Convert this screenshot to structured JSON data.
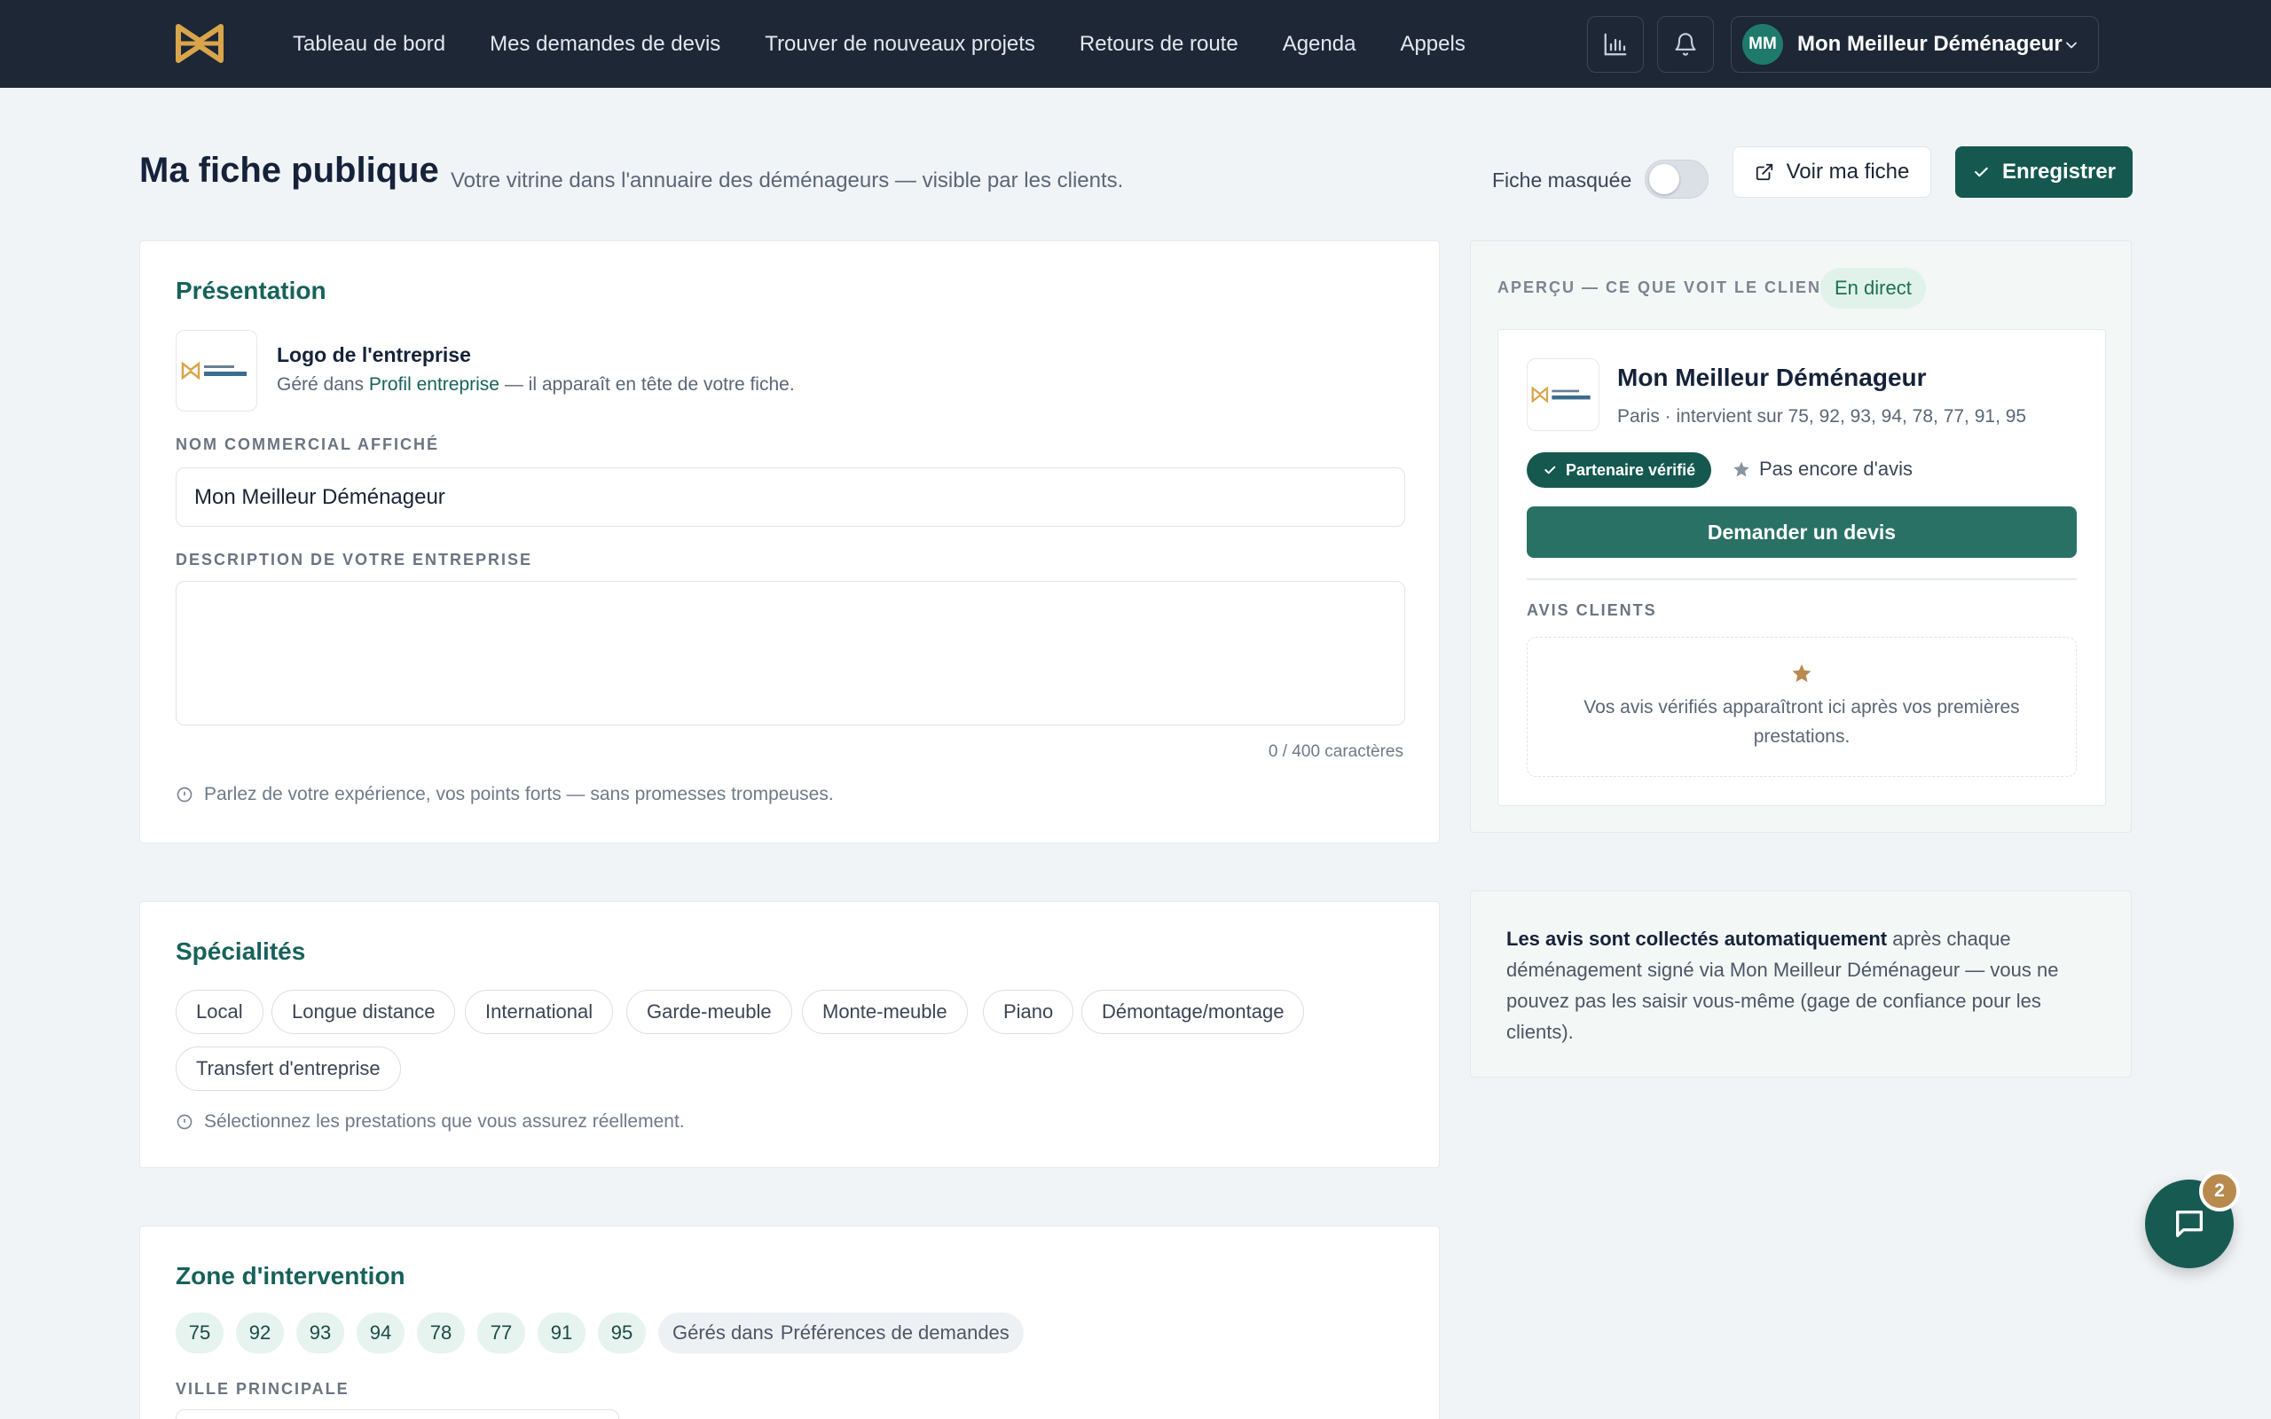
{
  "nav": {
    "links": [
      "Tableau de bord",
      "Mes demandes de devis",
      "Trouver de nouveaux projets",
      "Retours de route",
      "Agenda",
      "Appels"
    ],
    "user_initials": "MM",
    "user_name": "Mon Meilleur Déménageur"
  },
  "header": {
    "title": "Ma fiche publique",
    "subtitle": "Votre vitrine dans l'annuaire des déménageurs — visible par les clients.",
    "hidden_label": "Fiche masquée",
    "hidden_on": false,
    "view_button": "Voir ma fiche",
    "save_button": "Enregistrer"
  },
  "presentation": {
    "title": "Présentation",
    "logo_title": "Logo de l'entreprise",
    "logo_desc_before": "Géré dans",
    "logo_desc_link": "Profil entreprise",
    "logo_desc_after": "— il apparaît en tête de votre fiche.",
    "name_label": "NOM COMMERCIAL AFFICHÉ",
    "name_value": "Mon Meilleur Déménageur",
    "desc_label": "DESCRIPTION DE VOTRE ENTREPRISE",
    "desc_value": "",
    "char_count": "0 / 400 caractères",
    "hint": "Parlez de votre expérience, vos points forts — sans promesses trompeuses."
  },
  "specialties": {
    "title": "Spécialités",
    "items": [
      "Local",
      "Longue distance",
      "International",
      "Garde-meuble",
      "Monte-meuble",
      "Piano",
      "Démontage/montage",
      "Transfert d'entreprise"
    ],
    "hint": "Sélectionnez les prestations que vous assurez réellement."
  },
  "zone": {
    "title": "Zone d'intervention",
    "departments": [
      "75",
      "92",
      "93",
      "94",
      "78",
      "77",
      "91",
      "95"
    ],
    "managed_prefix": "Gérés dans",
    "managed_link": "Préférences de demandes",
    "city_label": "VILLE PRINCIPALE"
  },
  "preview": {
    "label": "APERÇU — CE QUE VOIT LE CLIENT",
    "live_badge": "En direct",
    "company_name": "Mon Meilleur Déménageur",
    "location": "Paris · intervient sur 75, 92, 93, 94, 78, 77, 91, 95",
    "verified_badge": "Partenaire vérifié",
    "no_reviews": "Pas encore d'avis",
    "quote_button": "Demander un devis",
    "reviews_title": "AVIS CLIENTS",
    "reviews_empty": "Vos avis vérifiés apparaîtront ici après vos premières prestations."
  },
  "info": {
    "bold": "Les avis sont collectés automatiquement",
    "text": " après chaque déménagement signé via Mon Meilleur Déménageur — vous ne pouvez pas les saisir vous-même (gage de confiance pour les clients)."
  },
  "chat": {
    "badge_count": "2"
  },
  "colors": {
    "nav_bg": "#1d2736",
    "accent": "#14584f",
    "title_green": "#17625a",
    "gold": "#b88a4e"
  }
}
